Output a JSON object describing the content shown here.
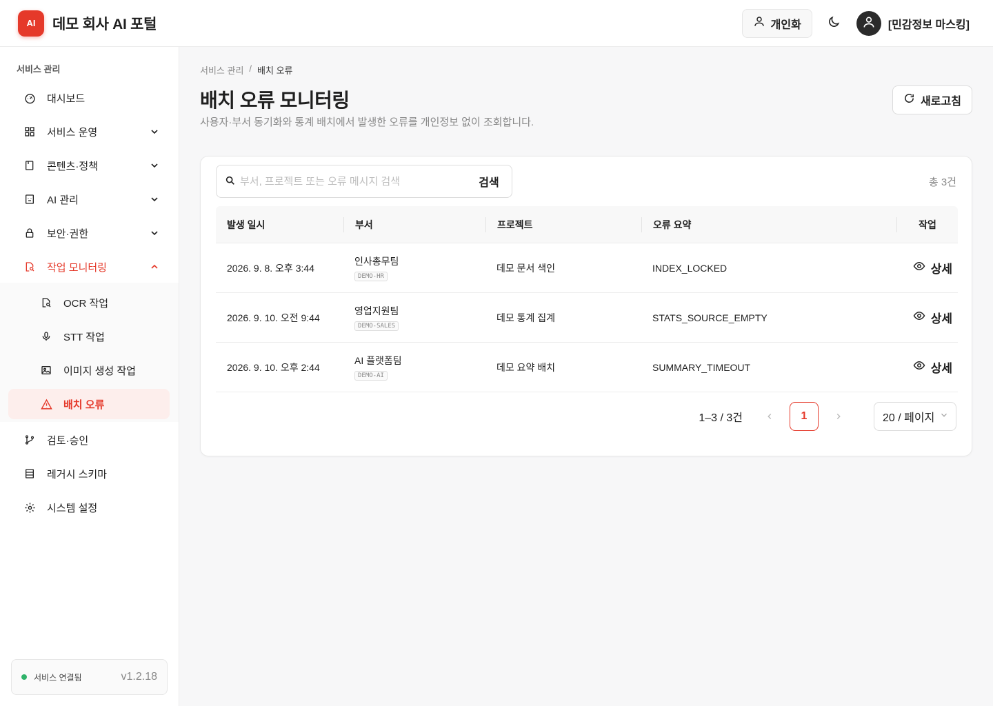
{
  "header": {
    "logo_text": "AI",
    "app_title": "데모 회사 AI 포털",
    "personalize_label": "개인화",
    "user_name": "[민감정보 마스킹]"
  },
  "sidebar": {
    "heading": "서비스 관리",
    "items": [
      {
        "label": "대시보드",
        "icon": "dashboard-icon"
      },
      {
        "label": "서비스 운영",
        "icon": "grid-icon"
      },
      {
        "label": "콘텐츠·정책",
        "icon": "document-icon"
      },
      {
        "label": "AI 관리",
        "icon": "robot-icon"
      },
      {
        "label": "보안·권한",
        "icon": "lock-icon"
      },
      {
        "label": "작업 모니터링",
        "icon": "file-search-icon"
      },
      {
        "label": "OCR 작업",
        "icon": "file-search-icon"
      },
      {
        "label": "STT 작업",
        "icon": "microphone-icon"
      },
      {
        "label": "이미지 생성 작업",
        "icon": "image-icon"
      },
      {
        "label": "배치 오류",
        "icon": "warning-icon"
      },
      {
        "label": "검토·승인",
        "icon": "branch-icon"
      },
      {
        "label": "레거시 스키마",
        "icon": "table-icon"
      },
      {
        "label": "시스템 설정",
        "icon": "gear-icon"
      }
    ],
    "status_text": "서비스 연결됨",
    "version": "v1.2.18"
  },
  "main": {
    "breadcrumb": [
      "서비스 관리",
      "/",
      "배치 오류"
    ],
    "title": "배치 오류 모니터링",
    "description": "사용자·부서 동기화와 통계 배치에서 발생한 오류를 개인정보 없이 조회합니다.",
    "refresh_label": "새로고침",
    "search": {
      "placeholder": "부서, 프로젝트 또는 오류 메시지 검색",
      "value": "",
      "button": "검색"
    },
    "total": "총 3건",
    "columns": [
      "발생 일시",
      "부서",
      "프로젝트",
      "오류 요약",
      "작업"
    ],
    "rows": [
      {
        "time": "2026. 9. 8. 오후 3:44",
        "dept": "인사총무팀",
        "code": "DEMO-HR",
        "project": "데모 문서 색인",
        "error": "INDEX_LOCKED",
        "action": "상세"
      },
      {
        "time": "2026. 9. 10. 오전 9:44",
        "dept": "영업지원팀",
        "code": "DEMO-SALES",
        "project": "데모 통계 집계",
        "error": "STATS_SOURCE_EMPTY",
        "action": "상세"
      },
      {
        "time": "2026. 9. 10. 오후 2:44",
        "dept": "AI 플랫폼팀",
        "code": "DEMO-AI",
        "project": "데모 요약 배치",
        "error": "SUMMARY_TIMEOUT",
        "action": "상세"
      }
    ],
    "pagination": {
      "range": "1–3 / 3건",
      "current_page": "1",
      "page_size": "20 / 페이지"
    }
  },
  "colors": {
    "accent": "#e5392a",
    "status_ok": "#2fb36a"
  }
}
